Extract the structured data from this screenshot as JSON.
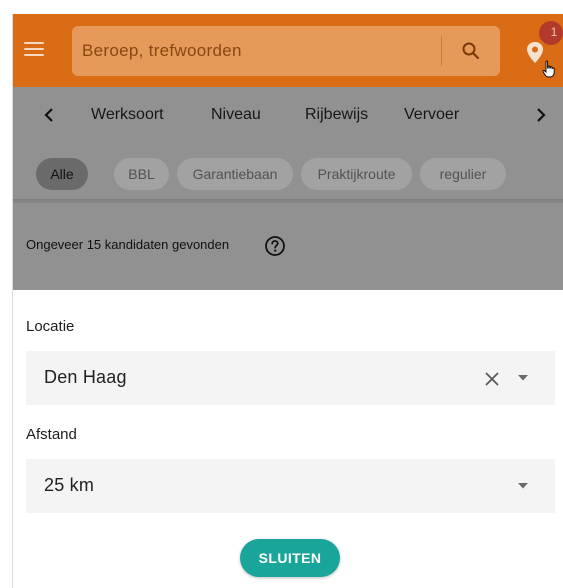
{
  "header": {
    "search_placeholder": "Beroep, trefwoorden",
    "notification_count": "1",
    "icons": {
      "menu": "hamburger-menu-icon",
      "search": "magnifier-icon",
      "location": "map-pin-icon",
      "cursor": "hand-pointer-icon"
    },
    "colors": {
      "appbar": "#d96c14",
      "search_box": "#e59a5a",
      "badge": "#b23a2a"
    }
  },
  "categories": {
    "items": [
      "Werksoort",
      "Niveau",
      "Rijbewijs",
      "Vervoer"
    ],
    "prev_icon": "chevron-left-icon",
    "next_icon": "chevron-right-icon"
  },
  "chips": {
    "items": [
      "Alle",
      "BBL",
      "Garantiebaan",
      "Praktijkroute",
      "regulier"
    ],
    "selected": "Alle"
  },
  "results": {
    "text": "Ongeveer 15 kandidaten gevonden",
    "help_icon": "question-circle-icon"
  },
  "sheet": {
    "location_label": "Locatie",
    "location_value": "Den Haag",
    "distance_label": "Afstand",
    "distance_value": "25 km",
    "close_label": "SLUITEN",
    "colors": {
      "close_button": "#1aa59b",
      "field_bg": "#f4f4f4"
    }
  }
}
